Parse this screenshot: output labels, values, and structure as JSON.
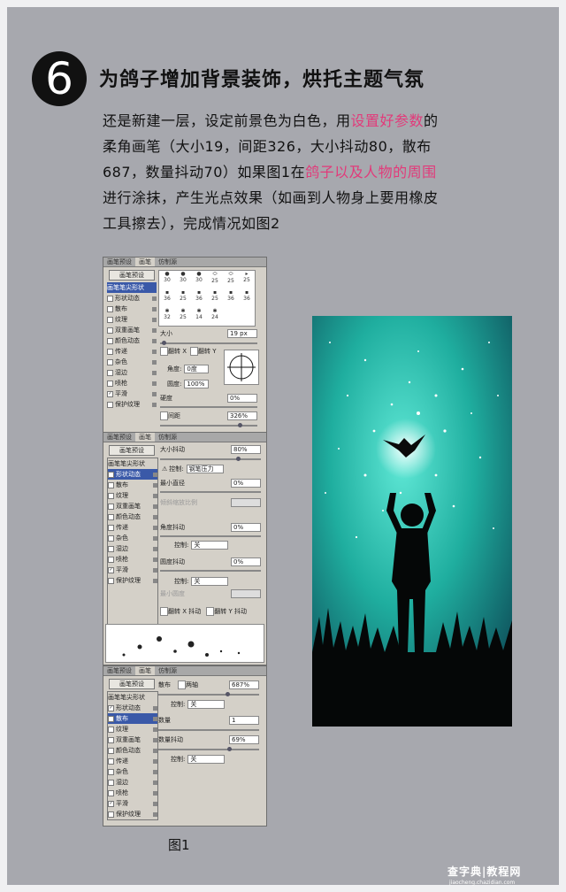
{
  "step": {
    "number": "6",
    "title": "为鸽子增加背景装饰，烘托主题气氛"
  },
  "paragraph": {
    "l1a": "还是新建一层，设定前景色为白色，用",
    "l1b": "设置好参数",
    "l1c": "的",
    "l2": "柔角画笔（大小19，间距326，大小抖动80，散布",
    "l3a": "687，数量抖动70）如果图1在",
    "l3b": "鸽子以及人物的周围",
    "l4": "进行涂抹，产生光点效果（如画到人物身上要用橡皮",
    "l5": "工具擦去），完成情况如图2"
  },
  "colors": {
    "highlight": "#e23a7a",
    "panel_bg": "#a7a8ae"
  },
  "panel1": {
    "tabs": [
      "画笔预设",
      "画笔",
      "仿制源"
    ],
    "preset_button": "画笔预设",
    "items": [
      "画笔笔尖形状",
      "形状动态",
      "散布",
      "纹理",
      "双重画笔",
      "颜色动态",
      "传递",
      "杂色",
      "湿边",
      "喷枪",
      "平滑",
      "保护纹理"
    ],
    "brush_sizes": [
      "30",
      "30",
      "30",
      "25",
      "25",
      "25",
      "36",
      "25",
      "36",
      "25",
      "36",
      "36",
      "32",
      "25",
      "14",
      "24"
    ],
    "size_label": "大小",
    "size_value": "19 px",
    "flip_x": "翻转 X",
    "flip_y": "翻转 Y",
    "angle_label": "角度:",
    "angle_value": "0度",
    "roundness_label": "圆度:",
    "roundness_value": "100%",
    "hardness_label": "硬度",
    "hardness_value": "0%",
    "spacing_label": "间距",
    "spacing_value": "326%"
  },
  "panel2": {
    "tabs": [
      "画笔预设",
      "画笔",
      "仿制源"
    ],
    "preset_button": "画笔预设",
    "items": [
      "画笔笔尖形状",
      "形状动态",
      "散布",
      "纹理",
      "双重画笔",
      "颜色动态",
      "传递",
      "杂色",
      "湿边",
      "喷枪",
      "平滑",
      "保护纹理"
    ],
    "size_jitter_label": "大小抖动",
    "size_jitter_value": "80%",
    "control_label": "控制:",
    "control1_value": "钢笔压力",
    "min_diameter_label": "最小直径",
    "min_diameter_value": "0%",
    "tilt_scale_label": "倾斜缩放比例",
    "angle_jitter_label": "角度抖动",
    "angle_jitter_value": "0%",
    "control2_value": "关",
    "roundness_jitter_label": "圆度抖动",
    "roundness_jitter_value": "0%",
    "control3_value": "关",
    "min_roundness_label": "最小圆度",
    "flip_x": "翻转 X 抖动",
    "flip_y": "翻转 Y 抖动"
  },
  "panel3": {
    "tabs": [
      "画笔预设",
      "画笔",
      "仿制源"
    ],
    "preset_button": "画笔预设",
    "items": [
      "画笔笔尖形状",
      "形状动态",
      "散布",
      "纹理",
      "双重画笔",
      "颜色动态",
      "传递",
      "杂色",
      "湿边",
      "喷枪",
      "平滑",
      "保护纹理"
    ],
    "scatter_label": "散布",
    "both_axes": "两轴",
    "scatter_value": "687%",
    "control_label": "控制:",
    "control_value": "关",
    "count_label": "数量",
    "count_value": "1",
    "count_jitter_label": "数量抖动",
    "count_jitter_value": "69%",
    "control2_value": "关"
  },
  "caption": "图1",
  "watermark": {
    "line1": "查字典|教程网",
    "line2": "jiaocheng.chazidian.com"
  }
}
